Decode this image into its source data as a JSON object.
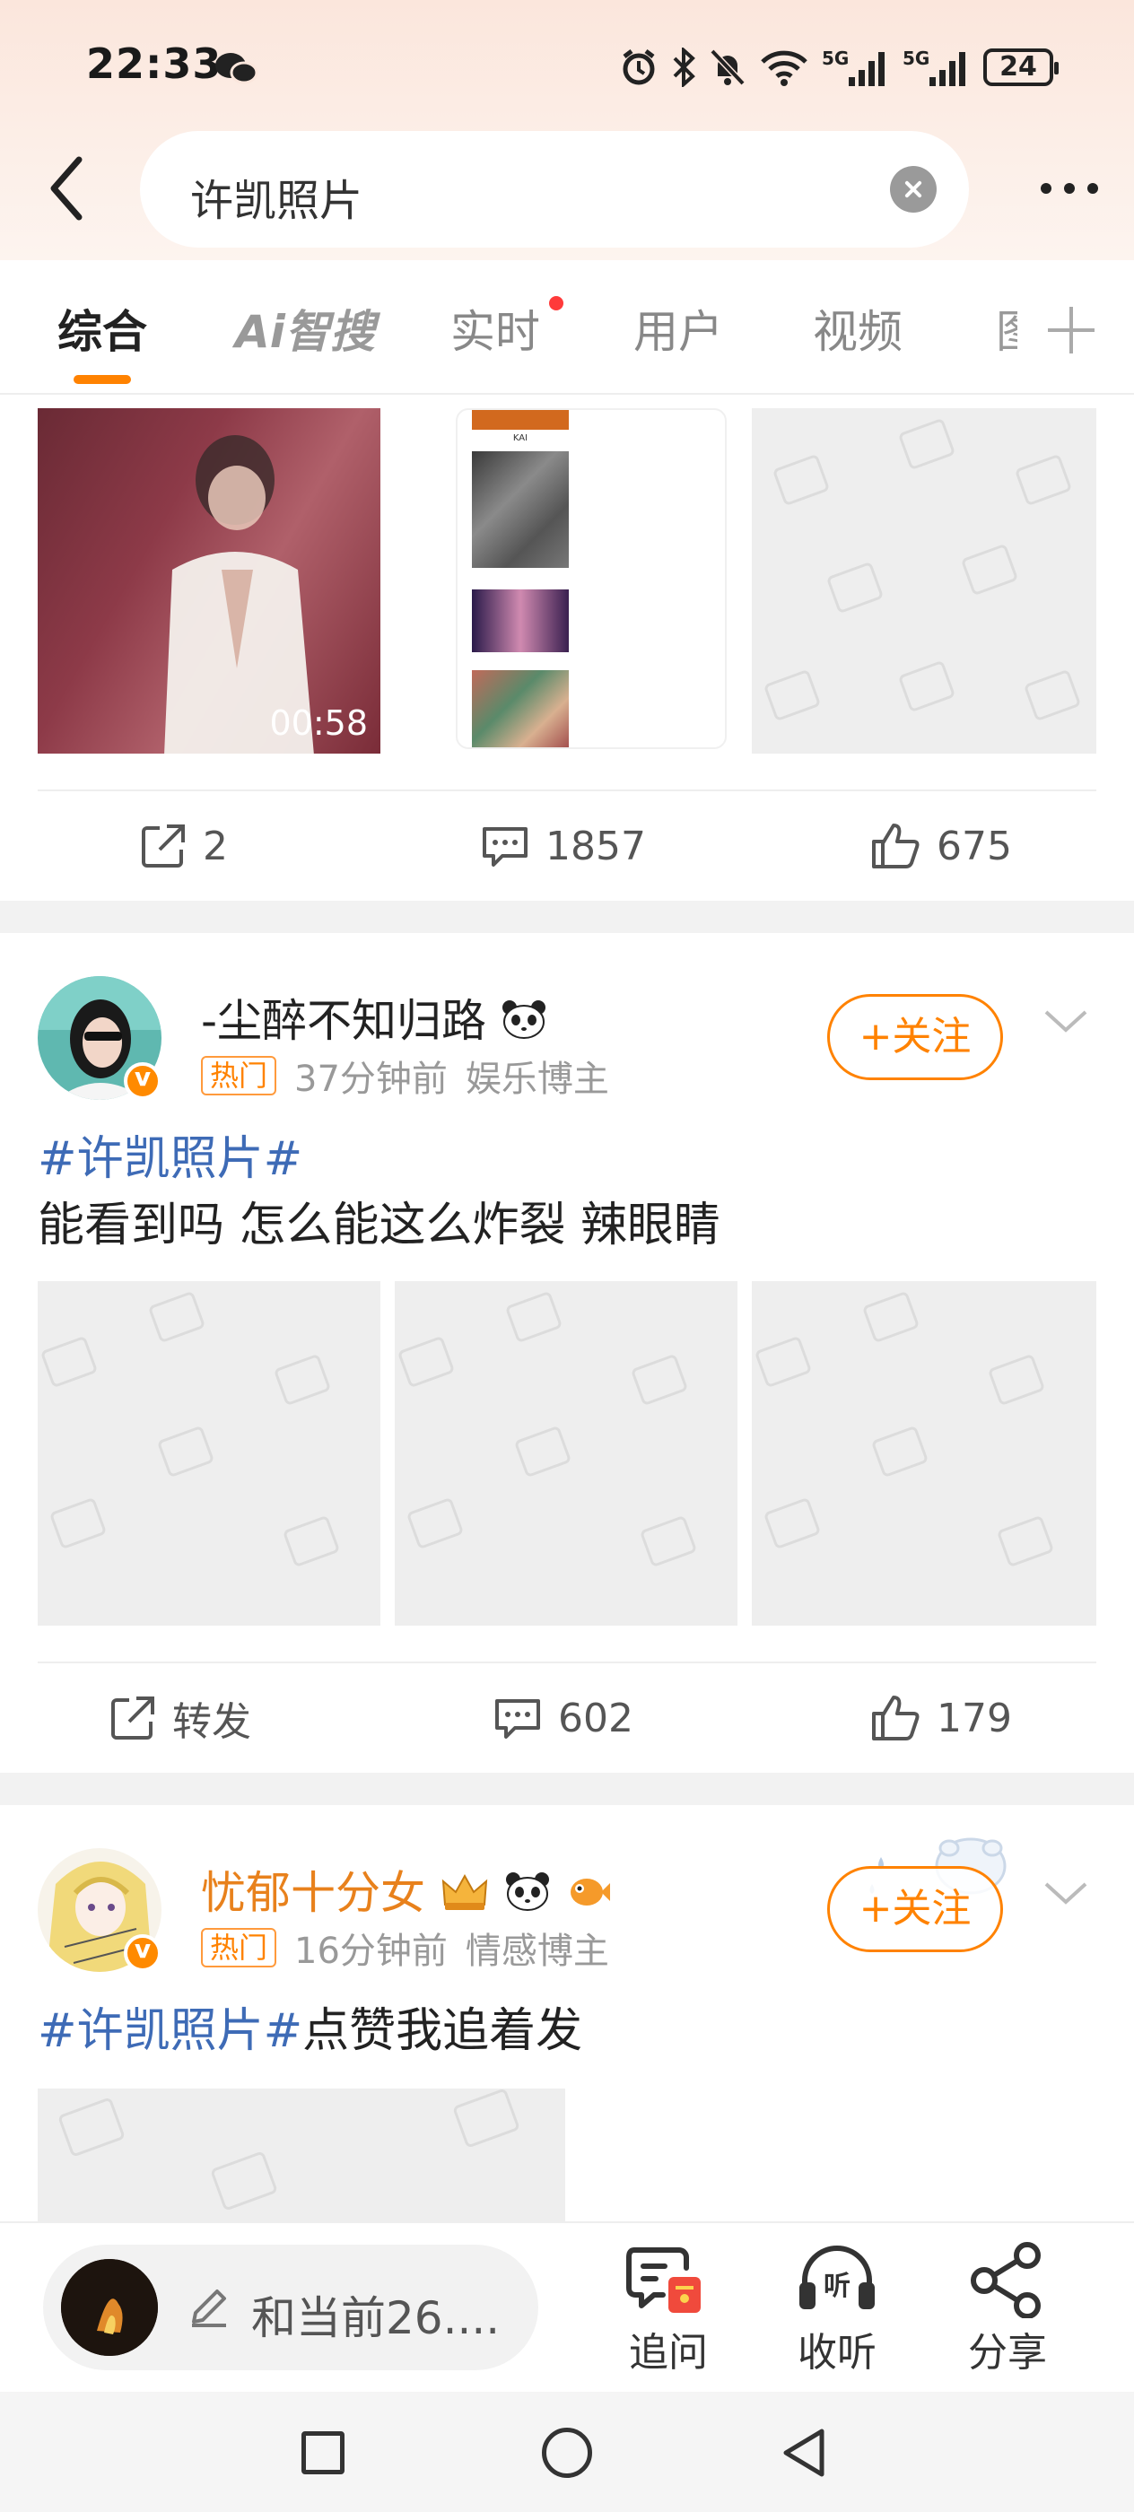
{
  "status_bar": {
    "time": "22:33",
    "battery": "24",
    "icons": [
      "wechat-icon",
      "alarm-icon",
      "bluetooth-icon",
      "mute-icon",
      "wifi-icon",
      "signal-5g-icon",
      "signal-5g-icon",
      "battery-icon"
    ]
  },
  "header": {
    "search_value": "许凯照片",
    "back_icon": "chevron-left-icon",
    "clear_icon": "clear-icon",
    "more_icon": "more-horizontal-icon"
  },
  "tabs": {
    "items": [
      "综合",
      "Ai智搜",
      "实时",
      "用户",
      "视频",
      "图"
    ],
    "active": "综合",
    "accent": "#ff8200"
  },
  "post1": {
    "video_duration": "00:58",
    "phone_shot_label": "KAI",
    "actions": {
      "repost": "2",
      "comments": "1857",
      "likes": "675"
    }
  },
  "post2": {
    "username": "-尘醉不知归路",
    "hot_badge": "热门",
    "time": "37分钟前",
    "category": "娱乐博主",
    "follow": "+关注",
    "hashtag": "#许凯照片#",
    "text": "能看到吗 怎么能这么炸裂 辣眼睛",
    "actions": {
      "repost": "转发",
      "comments": "602",
      "likes": "179"
    }
  },
  "post3": {
    "username": "忧郁十分女",
    "hot_badge": "热门",
    "time": "16分钟前",
    "category": "情感博主",
    "follow": "+关注",
    "hashtag": "#许凯照片#",
    "text": "点赞我追着发",
    "username_color": "#e8811c"
  },
  "bottom_bar": {
    "comment_placeholder": "和当前26....",
    "ask": "追问",
    "listen": "收听",
    "share": "分享"
  },
  "colors": {
    "accent": "#ff8200",
    "hashtag": "#3e6bb6",
    "placeholder": "#eeeeee"
  }
}
